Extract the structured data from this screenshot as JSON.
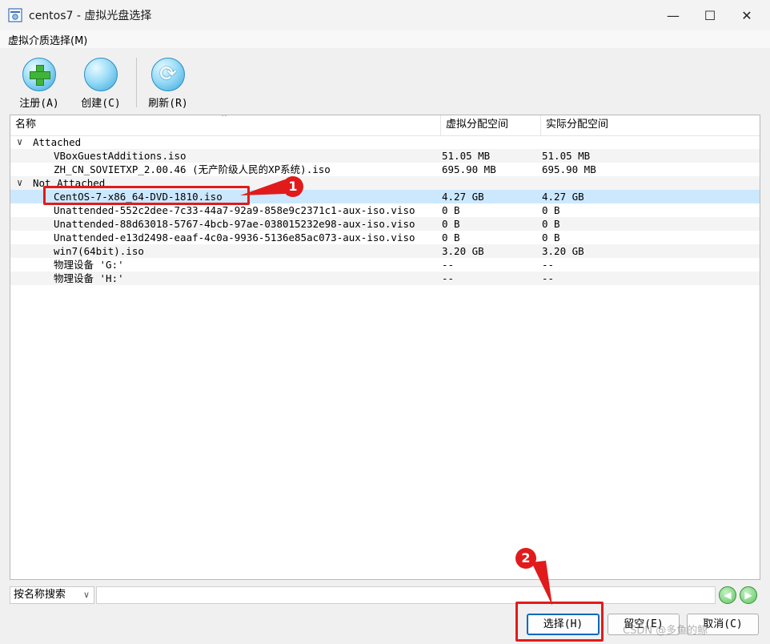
{
  "window": {
    "title": "centos7 - 虚拟光盘选择",
    "minimize": "—",
    "maximize": "☐",
    "close": "✕"
  },
  "menu": {
    "item": "虚拟介质选择(M)"
  },
  "toolbar": {
    "register_label": "注册(A)",
    "create_label": "创建(C)",
    "refresh_label": "刷新(R)"
  },
  "table": {
    "columns": [
      "名称",
      "虚拟分配空间",
      "实际分配空间"
    ],
    "groups": [
      {
        "label": "Attached",
        "items": [
          {
            "name": "VBoxGuestAdditions.iso",
            "virtual": "51.05 MB",
            "actual": "51.05 MB"
          },
          {
            "name": "ZH_CN_SOVIETXP_2.00.46 (无产阶级人民的XP系统).iso",
            "virtual": "695.90 MB",
            "actual": "695.90 MB"
          }
        ]
      },
      {
        "label": "Not Attached",
        "items": [
          {
            "name": "CentOS-7-x86_64-DVD-1810.iso",
            "virtual": "4.27 GB",
            "actual": "4.27 GB"
          },
          {
            "name": "Unattended-552c2dee-7c33-44a7-92a9-858e9c2371c1-aux-iso.viso",
            "virtual": "0 B",
            "actual": "0 B"
          },
          {
            "name": "Unattended-88d63018-5767-4bcb-97ae-038015232e98-aux-iso.viso",
            "virtual": "0 B",
            "actual": "0 B"
          },
          {
            "name": "Unattended-e13d2498-eaaf-4c0a-9936-5136e85ac073-aux-iso.viso",
            "virtual": "0 B",
            "actual": "0 B"
          },
          {
            "name": "win7(64bit).iso",
            "virtual": "3.20 GB",
            "actual": "3.20 GB"
          },
          {
            "name": "物理设备 'G:'",
            "virtual": "--",
            "actual": "--"
          },
          {
            "name": "物理设备 'H:'",
            "virtual": "--",
            "actual": "--"
          }
        ]
      }
    ]
  },
  "search": {
    "mode": "按名称搜索",
    "value": ""
  },
  "buttons": {
    "choose": "选择(H)",
    "leave_empty": "留空(E)",
    "cancel": "取消(C)"
  },
  "annotations": {
    "step1": "1",
    "step2": "2"
  },
  "watermark": "CSDN @多鱼的鲸",
  "colors": {
    "highlight": "#e11b1b",
    "selection": "#cce8ff",
    "accent": "#0067c0"
  }
}
